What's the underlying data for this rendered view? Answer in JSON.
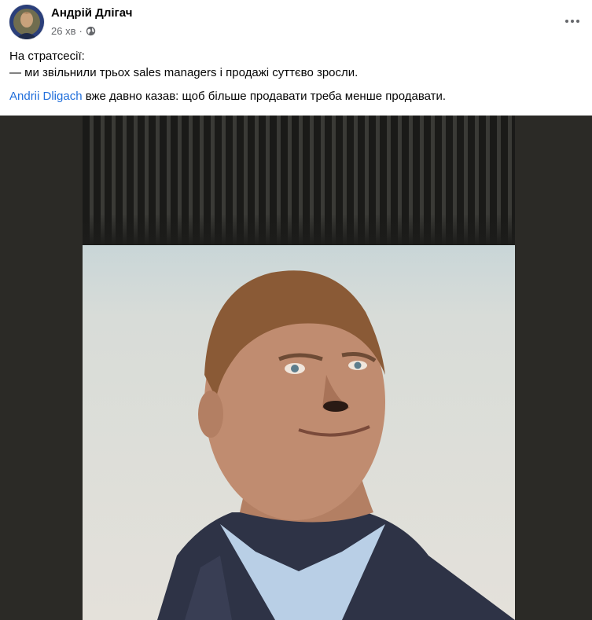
{
  "post": {
    "author_name": "Андрій Длігач",
    "timestamp": "26 хв",
    "separator": "·",
    "audience_icon": "globe-icon",
    "more_icon": "more-horizontal-icon",
    "text_line1": "На стратсесії:",
    "text_line2": "— ми звільнили трьох sales managers і продажі суттєво зросли.",
    "mention": "Andrii Dligach",
    "text_line3_rest": " вже давно казав: щоб більше продавати треба менше продавати."
  },
  "colors": {
    "link": "#216fdb",
    "secondary_text": "#65676b",
    "media_background": "#2b2a26"
  }
}
